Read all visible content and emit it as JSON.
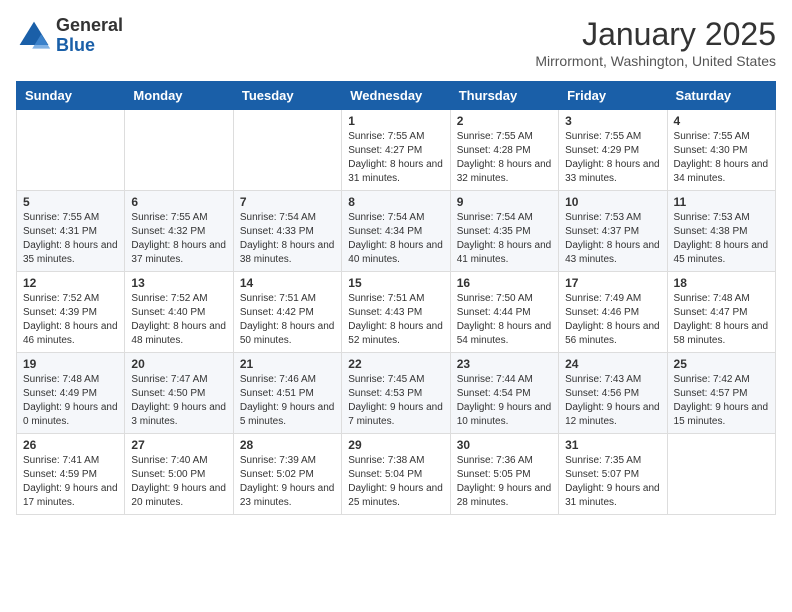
{
  "logo": {
    "general": "General",
    "blue": "Blue"
  },
  "header": {
    "month": "January 2025",
    "location": "Mirrormont, Washington, United States"
  },
  "weekdays": [
    "Sunday",
    "Monday",
    "Tuesday",
    "Wednesday",
    "Thursday",
    "Friday",
    "Saturday"
  ],
  "weeks": [
    [
      {
        "day": null
      },
      {
        "day": null
      },
      {
        "day": null
      },
      {
        "day": "1",
        "sunrise": "7:55 AM",
        "sunset": "4:27 PM",
        "daylight": "8 hours and 31 minutes."
      },
      {
        "day": "2",
        "sunrise": "7:55 AM",
        "sunset": "4:28 PM",
        "daylight": "8 hours and 32 minutes."
      },
      {
        "day": "3",
        "sunrise": "7:55 AM",
        "sunset": "4:29 PM",
        "daylight": "8 hours and 33 minutes."
      },
      {
        "day": "4",
        "sunrise": "7:55 AM",
        "sunset": "4:30 PM",
        "daylight": "8 hours and 34 minutes."
      }
    ],
    [
      {
        "day": "5",
        "sunrise": "7:55 AM",
        "sunset": "4:31 PM",
        "daylight": "8 hours and 35 minutes."
      },
      {
        "day": "6",
        "sunrise": "7:55 AM",
        "sunset": "4:32 PM",
        "daylight": "8 hours and 37 minutes."
      },
      {
        "day": "7",
        "sunrise": "7:54 AM",
        "sunset": "4:33 PM",
        "daylight": "8 hours and 38 minutes."
      },
      {
        "day": "8",
        "sunrise": "7:54 AM",
        "sunset": "4:34 PM",
        "daylight": "8 hours and 40 minutes."
      },
      {
        "day": "9",
        "sunrise": "7:54 AM",
        "sunset": "4:35 PM",
        "daylight": "8 hours and 41 minutes."
      },
      {
        "day": "10",
        "sunrise": "7:53 AM",
        "sunset": "4:37 PM",
        "daylight": "8 hours and 43 minutes."
      },
      {
        "day": "11",
        "sunrise": "7:53 AM",
        "sunset": "4:38 PM",
        "daylight": "8 hours and 45 minutes."
      }
    ],
    [
      {
        "day": "12",
        "sunrise": "7:52 AM",
        "sunset": "4:39 PM",
        "daylight": "8 hours and 46 minutes."
      },
      {
        "day": "13",
        "sunrise": "7:52 AM",
        "sunset": "4:40 PM",
        "daylight": "8 hours and 48 minutes."
      },
      {
        "day": "14",
        "sunrise": "7:51 AM",
        "sunset": "4:42 PM",
        "daylight": "8 hours and 50 minutes."
      },
      {
        "day": "15",
        "sunrise": "7:51 AM",
        "sunset": "4:43 PM",
        "daylight": "8 hours and 52 minutes."
      },
      {
        "day": "16",
        "sunrise": "7:50 AM",
        "sunset": "4:44 PM",
        "daylight": "8 hours and 54 minutes."
      },
      {
        "day": "17",
        "sunrise": "7:49 AM",
        "sunset": "4:46 PM",
        "daylight": "8 hours and 56 minutes."
      },
      {
        "day": "18",
        "sunrise": "7:48 AM",
        "sunset": "4:47 PM",
        "daylight": "8 hours and 58 minutes."
      }
    ],
    [
      {
        "day": "19",
        "sunrise": "7:48 AM",
        "sunset": "4:49 PM",
        "daylight": "9 hours and 0 minutes."
      },
      {
        "day": "20",
        "sunrise": "7:47 AM",
        "sunset": "4:50 PM",
        "daylight": "9 hours and 3 minutes."
      },
      {
        "day": "21",
        "sunrise": "7:46 AM",
        "sunset": "4:51 PM",
        "daylight": "9 hours and 5 minutes."
      },
      {
        "day": "22",
        "sunrise": "7:45 AM",
        "sunset": "4:53 PM",
        "daylight": "9 hours and 7 minutes."
      },
      {
        "day": "23",
        "sunrise": "7:44 AM",
        "sunset": "4:54 PM",
        "daylight": "9 hours and 10 minutes."
      },
      {
        "day": "24",
        "sunrise": "7:43 AM",
        "sunset": "4:56 PM",
        "daylight": "9 hours and 12 minutes."
      },
      {
        "day": "25",
        "sunrise": "7:42 AM",
        "sunset": "4:57 PM",
        "daylight": "9 hours and 15 minutes."
      }
    ],
    [
      {
        "day": "26",
        "sunrise": "7:41 AM",
        "sunset": "4:59 PM",
        "daylight": "9 hours and 17 minutes."
      },
      {
        "day": "27",
        "sunrise": "7:40 AM",
        "sunset": "5:00 PM",
        "daylight": "9 hours and 20 minutes."
      },
      {
        "day": "28",
        "sunrise": "7:39 AM",
        "sunset": "5:02 PM",
        "daylight": "9 hours and 23 minutes."
      },
      {
        "day": "29",
        "sunrise": "7:38 AM",
        "sunset": "5:04 PM",
        "daylight": "9 hours and 25 minutes."
      },
      {
        "day": "30",
        "sunrise": "7:36 AM",
        "sunset": "5:05 PM",
        "daylight": "9 hours and 28 minutes."
      },
      {
        "day": "31",
        "sunrise": "7:35 AM",
        "sunset": "5:07 PM",
        "daylight": "9 hours and 31 minutes."
      },
      {
        "day": null
      }
    ]
  ],
  "labels": {
    "sunrise_prefix": "Sunrise: ",
    "sunset_prefix": "Sunset: ",
    "daylight_prefix": "Daylight: "
  }
}
